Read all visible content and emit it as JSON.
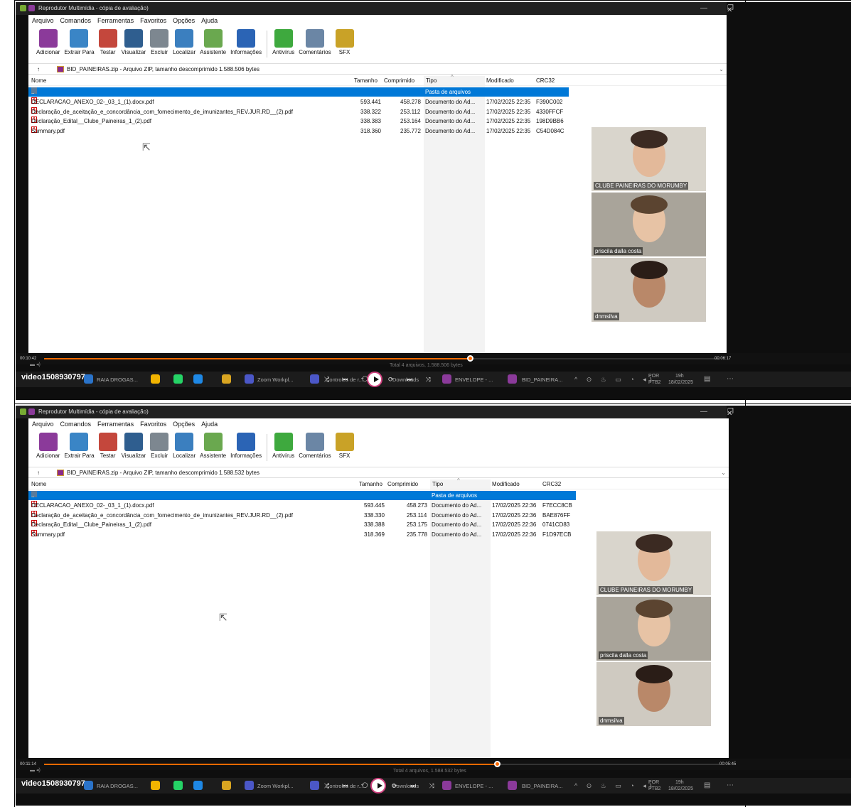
{
  "panels": [
    {
      "title": "Reprodutor Multimídia - cópia de avaliação)",
      "menu": [
        "Arquivo",
        "Comandos",
        "Ferramentas",
        "Favoritos",
        "Opções",
        "Ajuda"
      ],
      "tools": [
        {
          "label": "Adicionar",
          "icon": "rar-add-icon",
          "color": "#8b3a9a"
        },
        {
          "label": "Extrair Para",
          "icon": "folder-extract-icon",
          "color": "#3a85c6"
        },
        {
          "label": "Testar",
          "icon": "test-icon",
          "color": "#c4473c"
        },
        {
          "label": "Visualizar",
          "icon": "book-icon",
          "color": "#2f5e8f"
        },
        {
          "label": "Excluir",
          "icon": "trash-icon",
          "color": "#7d8790"
        },
        {
          "label": "Localizar",
          "icon": "magnifier-icon",
          "color": "#3b7fbf"
        },
        {
          "label": "Assistente",
          "icon": "wand-icon",
          "color": "#6aa84f"
        },
        {
          "label": "Informações",
          "icon": "info-icon",
          "color": "#2b64b5"
        },
        {
          "label": "Antivírus",
          "icon": "antivirus-icon",
          "color": "#3ea93e"
        },
        {
          "label": "Comentários",
          "icon": "comments-icon",
          "color": "#6b86a5"
        },
        {
          "label": "SFX",
          "icon": "sfx-icon",
          "color": "#c9a227"
        }
      ],
      "address": "BID_PAINEIRAS.zip - Arquivo ZIP, tamanho descomprimido 1.588.506 bytes",
      "columns": [
        "Nome",
        "Tamanho",
        "Comprimido",
        "Tipo",
        "Modificado",
        "CRC32"
      ],
      "folder_row": {
        "name": "..",
        "type": "Pasta de arquivos"
      },
      "files": [
        {
          "name": "DECLARACAO_ANEXO_02-_03_1_(1).docx.pdf",
          "size": "593.441",
          "packed": "458.278",
          "type": "Documento do Ad...",
          "modified": "17/02/2025 22:35",
          "crc": "F390C002"
        },
        {
          "name": "Declaração_de_aceitação_e_concordância_com_fornecimento_de_imunizantes_REV.JUR.RD__(2).pdf",
          "size": "338.322",
          "packed": "253.112",
          "type": "Documento do Ad...",
          "modified": "17/02/2025 22:35",
          "crc": "4330FFCF"
        },
        {
          "name": "Declaração_Edital__Clube_Paineiras_1_(2).pdf",
          "size": "338.383",
          "packed": "253.164",
          "type": "Documento do Ad...",
          "modified": "17/02/2025 22:35",
          "crc": "198D9BB6"
        },
        {
          "name": "Summary.pdf",
          "size": "318.360",
          "packed": "235.772",
          "type": "Documento do Ad...",
          "modified": "17/02/2025 22:35",
          "crc": "C54D084C"
        }
      ],
      "participants": [
        "CLUBE PAINEIRAS DO MORUMBY",
        "priscila dalla costa",
        "dnmsilva"
      ],
      "time_elapsed": "00:10:42",
      "time_remaining": "00:06:17",
      "progress": 0.63,
      "status": "Total 4 arquivos, 1.588.506 bytes",
      "video_name": "video1508930797",
      "taskbar": {
        "raia": "RAIA DROGAS...",
        "zoom": "Zoom Workpl...",
        "controles": "Controles de r...",
        "downloads": "Downloads",
        "envelope": "ENVELOPE - ...",
        "bid": "BID_PAINEIRA...",
        "lang": "POR",
        "layout": "PTB2",
        "date": "18/02/2025",
        "clock": "19h"
      }
    },
    {
      "title": "Reprodutor Multimídia - cópia de avaliação)",
      "menu": [
        "Arquivo",
        "Comandos",
        "Ferramentas",
        "Favoritos",
        "Opções",
        "Ajuda"
      ],
      "tools": [
        {
          "label": "Adicionar",
          "icon": "rar-add-icon",
          "color": "#8b3a9a"
        },
        {
          "label": "Extrair Para",
          "icon": "folder-extract-icon",
          "color": "#3a85c6"
        },
        {
          "label": "Testar",
          "icon": "test-icon",
          "color": "#c4473c"
        },
        {
          "label": "Visualizar",
          "icon": "book-icon",
          "color": "#2f5e8f"
        },
        {
          "label": "Excluir",
          "icon": "trash-icon",
          "color": "#7d8790"
        },
        {
          "label": "Localizar",
          "icon": "magnifier-icon",
          "color": "#3b7fbf"
        },
        {
          "label": "Assistente",
          "icon": "wand-icon",
          "color": "#6aa84f"
        },
        {
          "label": "Informações",
          "icon": "info-icon",
          "color": "#2b64b5"
        },
        {
          "label": "Antivírus",
          "icon": "antivirus-icon",
          "color": "#3ea93e"
        },
        {
          "label": "Comentários",
          "icon": "comments-icon",
          "color": "#6b86a5"
        },
        {
          "label": "SFX",
          "icon": "sfx-icon",
          "color": "#c9a227"
        }
      ],
      "address": "BID_PAINEIRAS.zip - Arquivo ZIP, tamanho descomprimido 1.588.532 bytes",
      "columns": [
        "Nome",
        "Tamanho",
        "Comprimido",
        "Tipo",
        "Modificado",
        "CRC32"
      ],
      "folder_row": {
        "name": "..",
        "type": "Pasta de arquivos"
      },
      "files": [
        {
          "name": "DECLARACAO_ANEXO_02-_03_1_(1).docx.pdf",
          "size": "593.445",
          "packed": "458.273",
          "type": "Documento do Ad...",
          "modified": "17/02/2025 22:36",
          "crc": "F7ECC8CB"
        },
        {
          "name": "Declaração_de_aceitação_e_concordância_com_fornecimento_de_imunizantes_REV.JUR.RD__(2).pdf",
          "size": "338.330",
          "packed": "253.114",
          "type": "Documento do Ad...",
          "modified": "17/02/2025 22:36",
          "crc": "BAE876FF"
        },
        {
          "name": "Declaração_Edital__Clube_Paineiras_1_(2).pdf",
          "size": "338.388",
          "packed": "253.175",
          "type": "Documento do Ad...",
          "modified": "17/02/2025 22:36",
          "crc": "0741CD83"
        },
        {
          "name": "Summary.pdf",
          "size": "318.369",
          "packed": "235.778",
          "type": "Documento do Ad...",
          "modified": "17/02/2025 22:36",
          "crc": "F1D97ECB"
        }
      ],
      "participants": [
        "CLUBE PAINEIRAS DO MORUMBY",
        "priscila dalla costa",
        "dnmsilva"
      ],
      "time_elapsed": "00:11:14",
      "time_remaining": "00:05:45",
      "progress": 0.67,
      "status": "Total 4 arquivos, 1.588.532 bytes",
      "video_name": "video1508930797",
      "taskbar": {
        "raia": "RAIA DROGAS...",
        "zoom": "Zoom Workpl...",
        "controles": "Controles de r...",
        "downloads": "Downloads",
        "envelope": "ENVELOPE - ...",
        "bid": "BID_PAINEIRA...",
        "lang": "POR",
        "layout": "PTB2",
        "date": "18/02/2025",
        "clock": "19h"
      }
    }
  ]
}
